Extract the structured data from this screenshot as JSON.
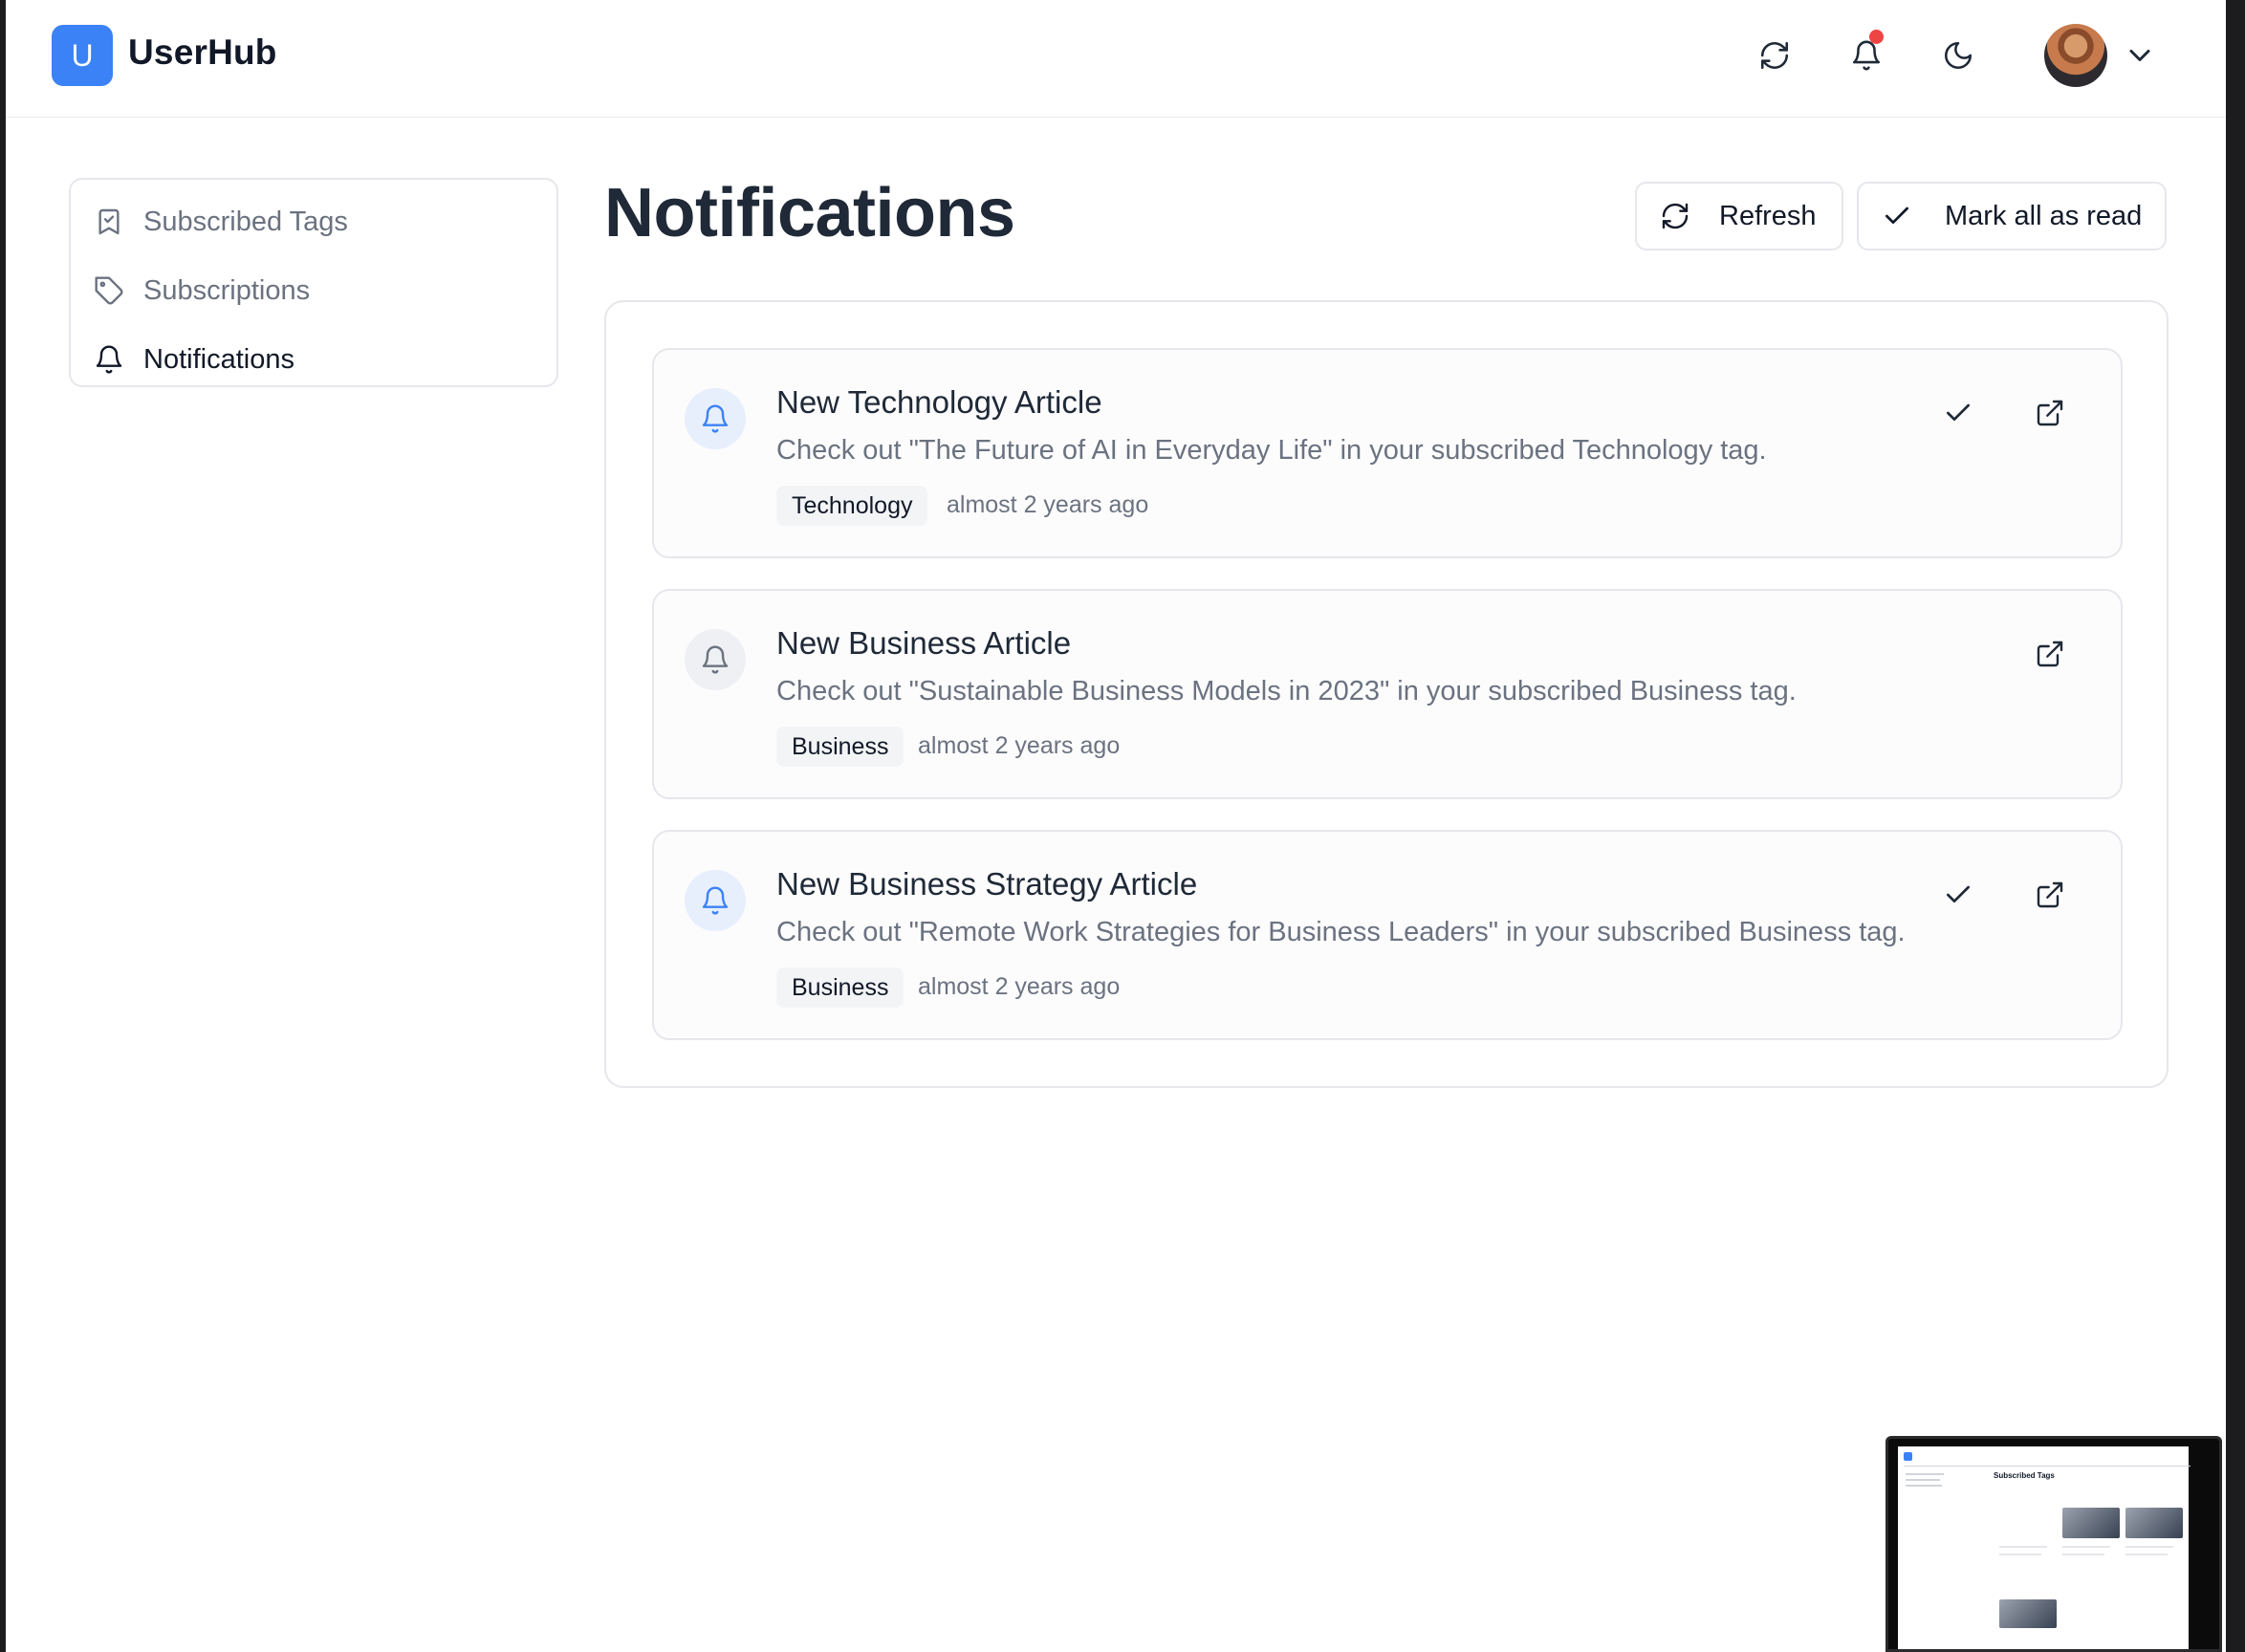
{
  "header": {
    "logo_letter": "U",
    "app_name": "UserHub",
    "icons": {
      "refresh": "refresh-icon",
      "notifications": "bell-icon",
      "theme": "moon-icon",
      "user_menu": "chevron-down-icon"
    },
    "has_unread_dot": true
  },
  "sidebar": {
    "items": [
      {
        "label": "Subscribed Tags",
        "icon": "bookmark-icon",
        "active": false
      },
      {
        "label": "Subscriptions",
        "icon": "tag-icon",
        "active": false
      },
      {
        "label": "Notifications",
        "icon": "bell-icon",
        "active": true
      }
    ]
  },
  "main": {
    "title": "Notifications",
    "refresh_label": "Refresh",
    "mark_all_label": "Mark all as read",
    "notifications": [
      {
        "title": "New Technology Article",
        "message": "Check out \"The Future of AI in Everyday Life\" in your subscribed Technology tag.",
        "tag": "Technology",
        "time": "almost 2 years ago",
        "unread": true
      },
      {
        "title": "New Business Article",
        "message": "Check out \"Sustainable Business Models in 2023\" in your subscribed Business tag.",
        "tag": "Business",
        "time": "almost 2 years ago",
        "unread": false
      },
      {
        "title": "New Business Strategy Article",
        "message": "Check out \"Remote Work Strategies for Business Leaders\" in your subscribed Business tag.",
        "tag": "Business",
        "time": "almost 2 years ago",
        "unread": true
      }
    ]
  },
  "preview": {
    "title": "Subscribed Tags"
  },
  "colors": {
    "accent": "#3b82f6",
    "notification_dot": "#ef4444",
    "text_primary": "#111827",
    "text_muted": "#6b7280",
    "border": "#e5e7eb"
  }
}
